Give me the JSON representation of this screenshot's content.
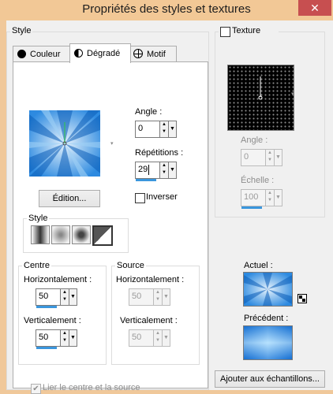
{
  "window": {
    "title": "Propriétés des styles et textures",
    "close_glyph": "✕"
  },
  "style_group": {
    "label": "Style"
  },
  "tabs": [
    {
      "label": "Couleur"
    },
    {
      "label": "Dégradé"
    },
    {
      "label": "Motif"
    }
  ],
  "gradient": {
    "preview_icon": "gradient-preview",
    "edit_button": "Édition...",
    "angle": {
      "label": "Angle :",
      "value": "0"
    },
    "repetitions": {
      "label": "Répétitions :",
      "value": "29"
    },
    "invert": {
      "label": "Inverser",
      "checked": false
    },
    "style_label": "Style",
    "center": {
      "label": "Centre",
      "horizontal_label": "Horizontalement :",
      "horizontal_value": "50",
      "vertical_label": "Verticalement :",
      "vertical_value": "50"
    },
    "source": {
      "label": "Source",
      "horizontal_label": "Horizontalement :",
      "horizontal_value": "50",
      "vertical_label": "Verticalement :",
      "vertical_value": "50"
    },
    "link": {
      "label": "Lier le centre et la source",
      "checked": true
    }
  },
  "texture": {
    "label": "Texture",
    "checked": false,
    "angle": {
      "label": "Angle :",
      "value": "0"
    },
    "scale": {
      "label": "Échelle :",
      "value": "100"
    }
  },
  "current": {
    "label": "Actuel :"
  },
  "previous": {
    "label": "Précédent :"
  },
  "add_button": "Ajouter aux échantillons..."
}
